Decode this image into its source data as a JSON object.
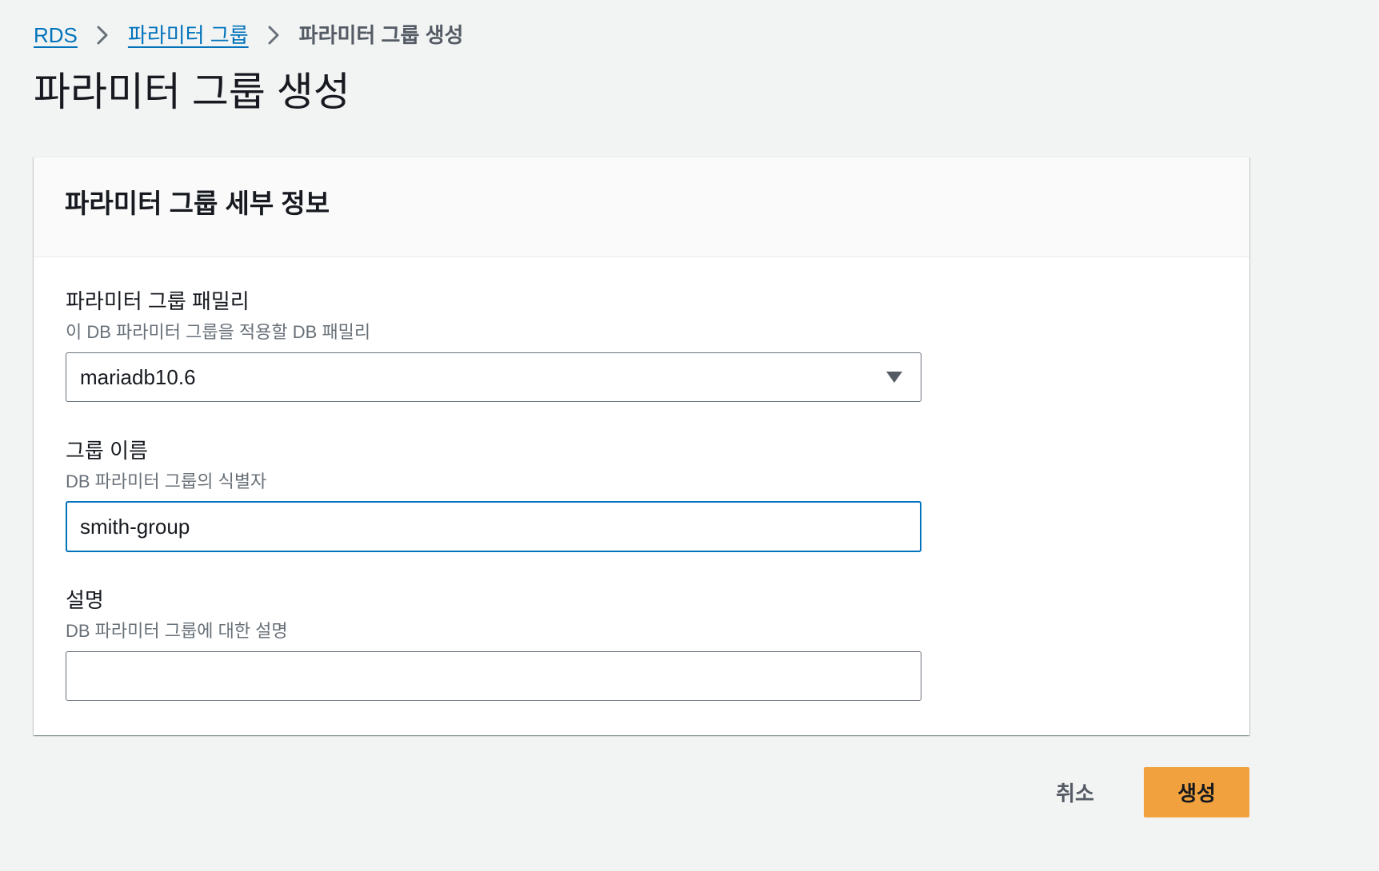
{
  "breadcrumb": {
    "items": [
      {
        "label": "RDS"
      },
      {
        "label": "파라미터 그룹"
      },
      {
        "label": "파라미터 그룹 생성"
      }
    ]
  },
  "page": {
    "title": "파라미터 그룹 생성"
  },
  "card": {
    "title": "파라미터 그룹 세부 정보"
  },
  "fields": {
    "family": {
      "label": "파라미터 그룹 패밀리",
      "description": "이 DB 파라미터 그룹을 적용할 DB 패밀리",
      "value": "mariadb10.6"
    },
    "name": {
      "label": "그룹 이름",
      "description": "DB 파라미터 그룹의 식별자",
      "value": "smith-group"
    },
    "description": {
      "label": "설명",
      "description": "DB 파라미터 그룹에 대한 설명",
      "value": ""
    }
  },
  "actions": {
    "cancel_label": "취소",
    "create_label": "생성"
  },
  "icons": {
    "breadcrumb_separator": "chevron-right-icon",
    "select_caret": "caret-down-icon"
  },
  "colors": {
    "background": "#f2f3f3",
    "link": "#0073bb",
    "focus_border": "#0073bb",
    "primary_button": "#f1a13d",
    "text": "#16191f",
    "secondary_text": "#687078"
  }
}
